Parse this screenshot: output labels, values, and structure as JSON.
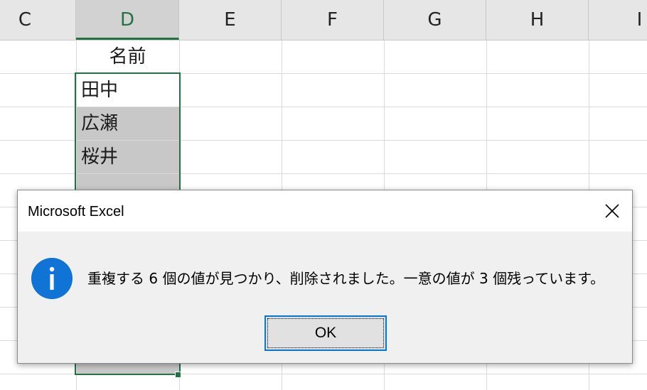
{
  "sheet": {
    "columns": [
      "C",
      "D",
      "E",
      "F",
      "G",
      "H",
      "I"
    ],
    "selected_column": "D",
    "header_cell": "名前",
    "values": [
      "田中",
      "広瀬",
      "桜井"
    ]
  },
  "dialog": {
    "title": "Microsoft Excel",
    "message": "重複する 6 個の値が見つかり、削除されました。一意の値が 3 個残っています。",
    "ok_label": "OK",
    "icon": "info-icon",
    "close_icon": "close-icon"
  },
  "colors": {
    "accent": "#217346",
    "focus": "#0078d7",
    "info_blue": "#0b6fcf"
  }
}
